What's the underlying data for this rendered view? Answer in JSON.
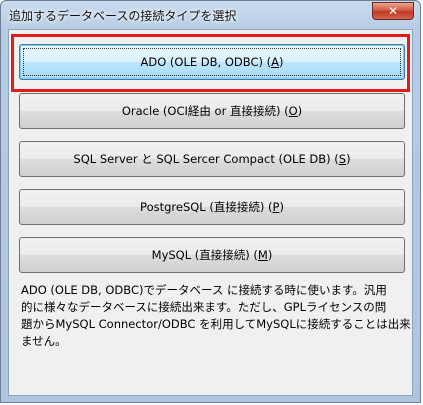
{
  "window": {
    "title": "追加するデータベースの接続タイプを選択",
    "close_glyph": "✕"
  },
  "options": [
    {
      "label": "ADO (OLE DB, ODBC) (",
      "mnemonic": "A",
      "suffix": ")"
    },
    {
      "label": "Oracle (OCI経由 or 直接接続) (",
      "mnemonic": "O",
      "suffix": ")"
    },
    {
      "label": "SQL Server と SQL Sercer Compact (OLE DB) (",
      "mnemonic": "S",
      "suffix": ")"
    },
    {
      "label": "PostgreSQL (直接接続) (",
      "mnemonic": "P",
      "suffix": ")"
    },
    {
      "label": "MySQL (直接接続) (",
      "mnemonic": "M",
      "suffix": ")"
    }
  ],
  "description": {
    "lines": [
      "ADO (OLE DB, ODBC)でデータベース に接続する時に使います。汎用",
      "的に様々なデータベースに接続出来ます。ただし、GPLライセンスの問",
      "題からMySQL Connector/ODBC を利用してMySQLに接続することは出来",
      "ません。"
    ]
  },
  "colors": {
    "highlight": "#e31b1b",
    "default_button_border": "#3c7fb1"
  }
}
